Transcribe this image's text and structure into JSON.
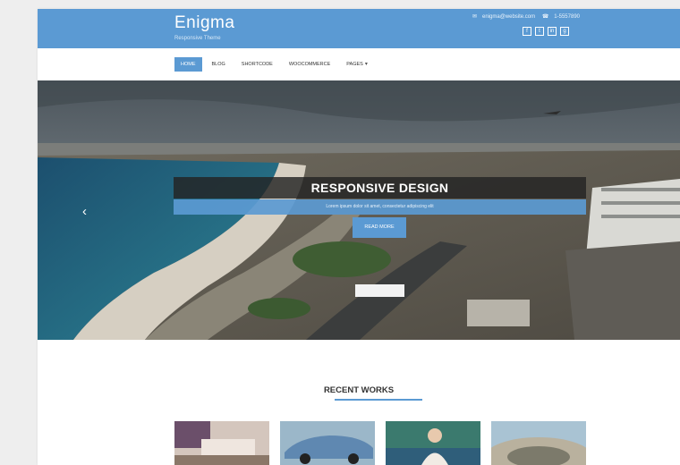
{
  "header": {
    "title": "Enigma",
    "tagline": "Responsive Theme",
    "email": "enigma@website.com",
    "phone": "1-5557890",
    "socials": [
      {
        "icon": "facebook-icon",
        "glyph": "f"
      },
      {
        "icon": "twitter-icon",
        "glyph": "t"
      },
      {
        "icon": "linkedin-icon",
        "glyph": "in"
      },
      {
        "icon": "google-plus-icon",
        "glyph": "g"
      }
    ]
  },
  "nav": {
    "items": [
      {
        "label": "HOME",
        "active": true
      },
      {
        "label": "BLOG",
        "active": false
      },
      {
        "label": "SHORTCODE",
        "active": false
      },
      {
        "label": "WOOCOMMERCE",
        "active": false
      },
      {
        "label": "PAGES",
        "active": false
      }
    ]
  },
  "hero": {
    "title": "RESPONSIVE DESIGN",
    "subtitle": "Lorem ipsum dolor sit amet, consectetur adipiscing elit",
    "button": "READ MORE",
    "prev_arrow": "‹"
  },
  "recent_works": {
    "title": "RECENT WORKS"
  },
  "colors": {
    "accent": "#5b9ad3",
    "caption_bg": "#232323",
    "page_bg": "#eeeeee"
  }
}
